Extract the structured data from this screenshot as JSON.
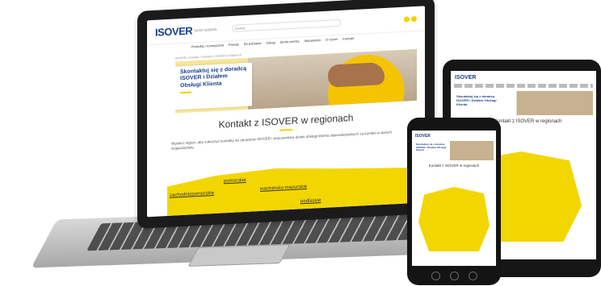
{
  "laptop": {
    "logo": "ISOVER",
    "logo_sub": "SAINT-GOBAIN",
    "search_placeholder": "Szukaj",
    "nav": [
      "Produkty i rozwiązania",
      "Porady",
      "Do pobrania",
      "Usługi",
      "Strefa wiedzy",
      "Aktualności",
      "O Isover",
      "Kontakt"
    ],
    "breadcrumb": "ISOVER > Kontakt > Kontakt z ISOVER w regionach",
    "hero_title": "Skontaktuj się z doradcą ISOVER i Działem Obsługi Klienta",
    "page_title": "Kontakt z ISOVER w regionach",
    "intro": "Wybierz region, aby zobaczyć kontakty do doradców ISOVER i pracowników działu obsługi klienta odpowiedzialnych za kontakt w danym województwie.",
    "regions": [
      "pomorskie",
      "zachodniopomorskie",
      "warmińsko-mazurskie",
      "podlaskie"
    ]
  },
  "tablet": {
    "logo": "ISOVER",
    "hero_title": "Skontaktuj się z doradcą ISOVER i Działem Obsługi Klienta",
    "page_title": "Kontakt z ISOVER w regionach"
  },
  "phone": {
    "logo": "ISOVER",
    "hero_title": "Skontaktuj się z doradcą ISOVER i Działem Obsługi Klienta",
    "page_title": "Kontakt z ISOVER w regionach"
  },
  "colors": {
    "brand_blue": "#1c3f8c",
    "accent_yellow": "#f5d000"
  }
}
